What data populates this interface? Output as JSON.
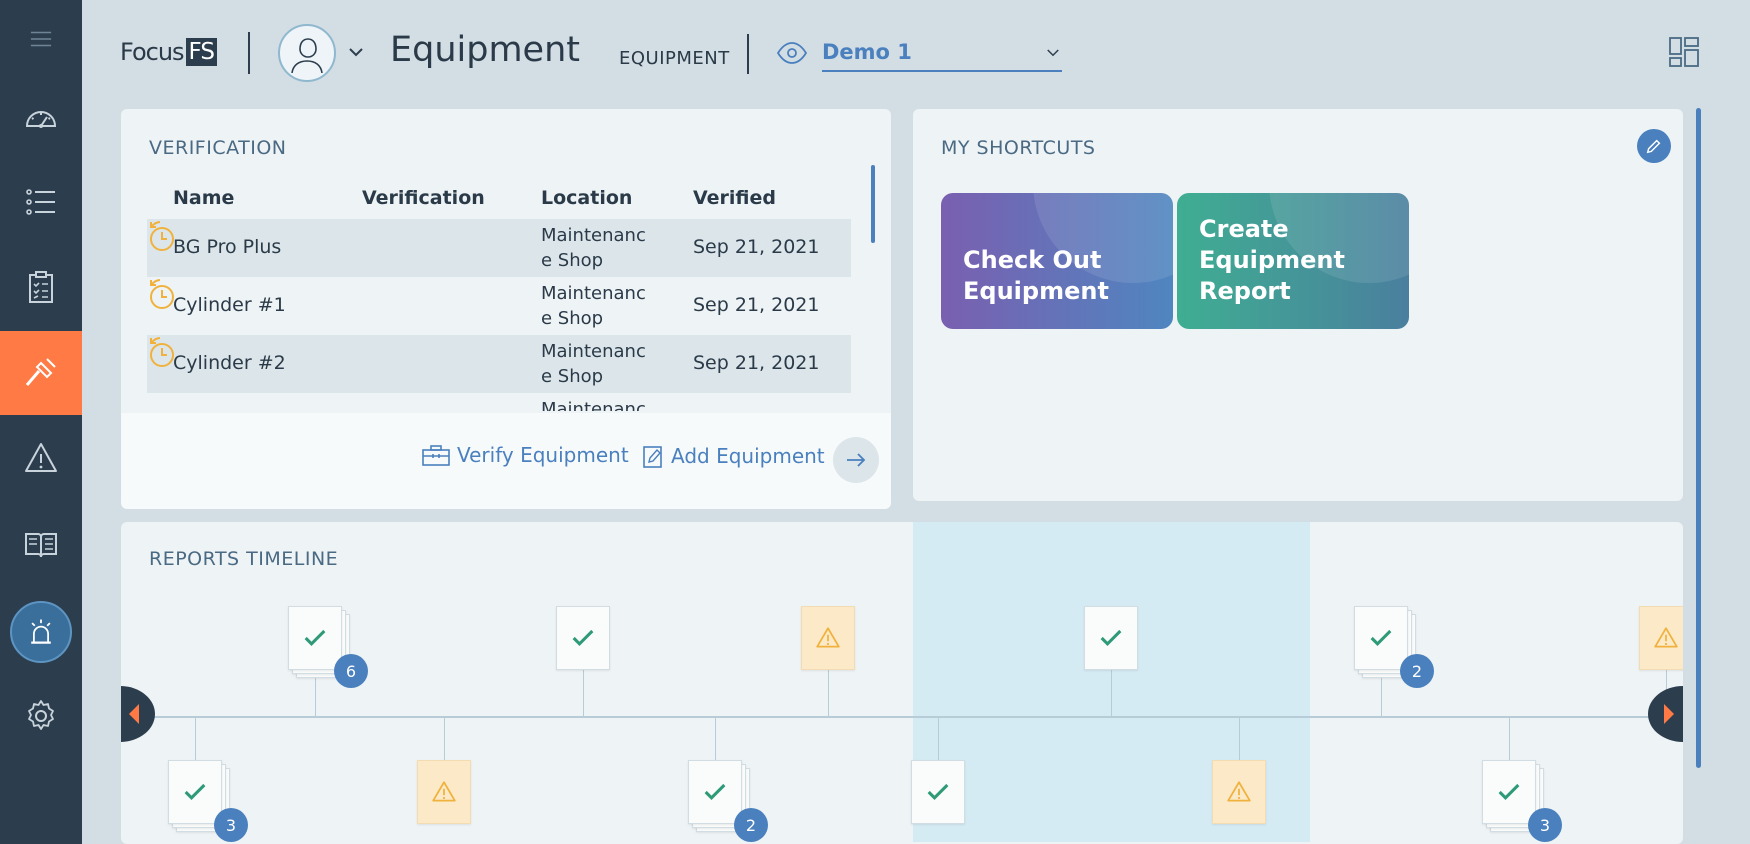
{
  "header": {
    "logo_text": "Focus",
    "logo_badge": "FS",
    "page_title": "Equipment",
    "breadcrumb": "EQUIPMENT",
    "demo_value": "Demo 1"
  },
  "verification": {
    "title": "VERIFICATION",
    "columns": [
      "Name",
      "Verification",
      "Location",
      "Verified"
    ],
    "rows": [
      {
        "name": "BG Pro Plus",
        "location": "Maintenanc e Shop",
        "verified": "Sep 21, 2021"
      },
      {
        "name": "Cylinder #1",
        "location": "Maintenanc e Shop",
        "verified": "Sep 21, 2021"
      },
      {
        "name": "Cylinder #2",
        "location": "Maintenanc e Shop",
        "verified": "Sep 21, 2021"
      },
      {
        "name": "",
        "location": "Maintenanc",
        "verified": ""
      }
    ],
    "verify_label": "Verify Equipment",
    "add_label": "Add Equipment"
  },
  "shortcuts": {
    "title": "MY SHORTCUTS",
    "items": [
      {
        "label": "Check Out Equipment",
        "color": "#7a5fb0"
      },
      {
        "label": "Create Equipment Report",
        "color": "#3fae92"
      }
    ]
  },
  "timeline": {
    "title": "REPORTS TIMELINE",
    "badges": [
      "6",
      "2",
      "3",
      "2",
      "3"
    ]
  },
  "colors": {
    "sidebar": "#2c3e4e",
    "active": "#ff7a45",
    "accent": "#4a80be",
    "clock": "#f0b23c"
  },
  "sidebar_icons": [
    "menu-icon",
    "dashboard-icon",
    "list-icon",
    "checklist-icon",
    "hammer-icon",
    "warning-icon",
    "manual-icon",
    "alarm-icon",
    "gear-icon"
  ]
}
